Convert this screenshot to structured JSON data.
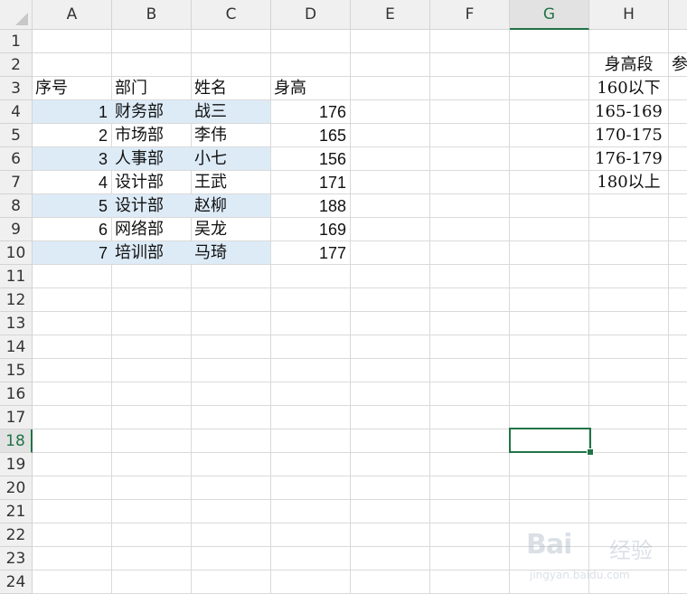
{
  "spreadsheet": {
    "columns": [
      "A",
      "B",
      "C",
      "D",
      "E",
      "F",
      "G",
      "H"
    ],
    "selected_column": "G",
    "rows": [
      "1",
      "2",
      "3",
      "4",
      "5",
      "6",
      "7",
      "8",
      "9",
      "10",
      "11",
      "12",
      "13",
      "14",
      "15",
      "16",
      "17",
      "18",
      "19",
      "20",
      "21",
      "22",
      "23",
      "24"
    ],
    "selected_row": "18",
    "active_cell": "G18",
    "header_row": {
      "index": "序号",
      "dept": "部门",
      "name": "姓名",
      "height": "身高"
    },
    "data_rows": [
      {
        "index": "1",
        "dept": "财务部",
        "name": "战三",
        "height": "176"
      },
      {
        "index": "2",
        "dept": "市场部",
        "name": "李伟",
        "height": "165"
      },
      {
        "index": "3",
        "dept": "人事部",
        "name": "小七",
        "height": "156"
      },
      {
        "index": "4",
        "dept": "设计部",
        "name": "王武",
        "height": "171"
      },
      {
        "index": "5",
        "dept": "设计部",
        "name": "赵柳",
        "height": "188"
      },
      {
        "index": "6",
        "dept": "网络部",
        "name": "吴龙",
        "height": "169"
      },
      {
        "index": "7",
        "dept": "培训部",
        "name": "马琦",
        "height": "177"
      }
    ],
    "range_header": "身高段",
    "range_header_next": "参",
    "ranges": [
      "160以下",
      "165-169",
      "170-175",
      "176-179",
      "180以上"
    ],
    "stripe_color": "#ddebf7",
    "accent_color": "#217346"
  },
  "watermark": {
    "brand": "Bai",
    "brand_suffix": "经验",
    "url": "jingyan.baidu.com"
  }
}
